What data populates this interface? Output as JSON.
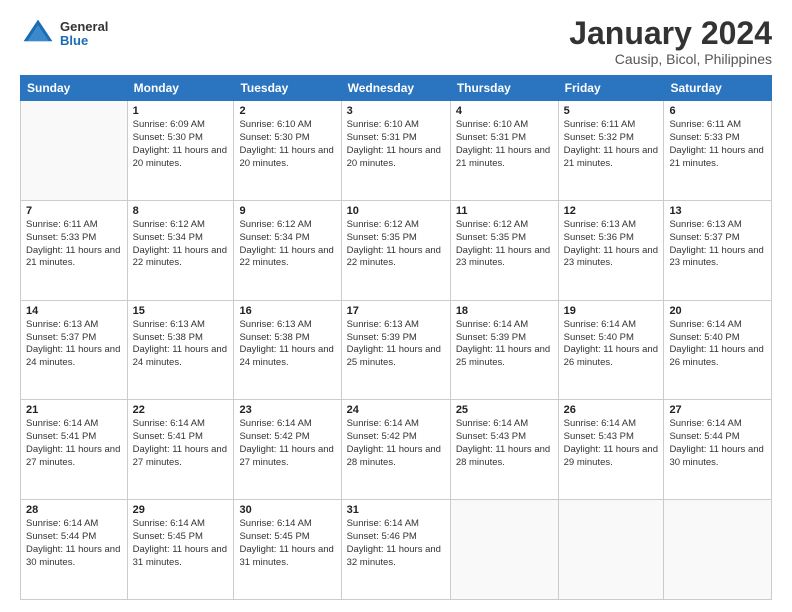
{
  "header": {
    "logo": {
      "general": "General",
      "blue": "Blue"
    },
    "title": "January 2024",
    "subtitle": "Causip, Bicol, Philippines"
  },
  "calendar": {
    "days_of_week": [
      "Sunday",
      "Monday",
      "Tuesday",
      "Wednesday",
      "Thursday",
      "Friday",
      "Saturday"
    ],
    "weeks": [
      [
        {
          "day": "",
          "info": ""
        },
        {
          "day": "1",
          "info": "Sunrise: 6:09 AM\nSunset: 5:30 PM\nDaylight: 11 hours\nand 20 minutes."
        },
        {
          "day": "2",
          "info": "Sunrise: 6:10 AM\nSunset: 5:30 PM\nDaylight: 11 hours\nand 20 minutes."
        },
        {
          "day": "3",
          "info": "Sunrise: 6:10 AM\nSunset: 5:31 PM\nDaylight: 11 hours\nand 20 minutes."
        },
        {
          "day": "4",
          "info": "Sunrise: 6:10 AM\nSunset: 5:31 PM\nDaylight: 11 hours\nand 21 minutes."
        },
        {
          "day": "5",
          "info": "Sunrise: 6:11 AM\nSunset: 5:32 PM\nDaylight: 11 hours\nand 21 minutes."
        },
        {
          "day": "6",
          "info": "Sunrise: 6:11 AM\nSunset: 5:33 PM\nDaylight: 11 hours\nand 21 minutes."
        }
      ],
      [
        {
          "day": "7",
          "info": "Sunrise: 6:11 AM\nSunset: 5:33 PM\nDaylight: 11 hours\nand 21 minutes."
        },
        {
          "day": "8",
          "info": "Sunrise: 6:12 AM\nSunset: 5:34 PM\nDaylight: 11 hours\nand 22 minutes."
        },
        {
          "day": "9",
          "info": "Sunrise: 6:12 AM\nSunset: 5:34 PM\nDaylight: 11 hours\nand 22 minutes."
        },
        {
          "day": "10",
          "info": "Sunrise: 6:12 AM\nSunset: 5:35 PM\nDaylight: 11 hours\nand 22 minutes."
        },
        {
          "day": "11",
          "info": "Sunrise: 6:12 AM\nSunset: 5:35 PM\nDaylight: 11 hours\nand 23 minutes."
        },
        {
          "day": "12",
          "info": "Sunrise: 6:13 AM\nSunset: 5:36 PM\nDaylight: 11 hours\nand 23 minutes."
        },
        {
          "day": "13",
          "info": "Sunrise: 6:13 AM\nSunset: 5:37 PM\nDaylight: 11 hours\nand 23 minutes."
        }
      ],
      [
        {
          "day": "14",
          "info": "Sunrise: 6:13 AM\nSunset: 5:37 PM\nDaylight: 11 hours\nand 24 minutes."
        },
        {
          "day": "15",
          "info": "Sunrise: 6:13 AM\nSunset: 5:38 PM\nDaylight: 11 hours\nand 24 minutes."
        },
        {
          "day": "16",
          "info": "Sunrise: 6:13 AM\nSunset: 5:38 PM\nDaylight: 11 hours\nand 24 minutes."
        },
        {
          "day": "17",
          "info": "Sunrise: 6:13 AM\nSunset: 5:39 PM\nDaylight: 11 hours\nand 25 minutes."
        },
        {
          "day": "18",
          "info": "Sunrise: 6:14 AM\nSunset: 5:39 PM\nDaylight: 11 hours\nand 25 minutes."
        },
        {
          "day": "19",
          "info": "Sunrise: 6:14 AM\nSunset: 5:40 PM\nDaylight: 11 hours\nand 26 minutes."
        },
        {
          "day": "20",
          "info": "Sunrise: 6:14 AM\nSunset: 5:40 PM\nDaylight: 11 hours\nand 26 minutes."
        }
      ],
      [
        {
          "day": "21",
          "info": "Sunrise: 6:14 AM\nSunset: 5:41 PM\nDaylight: 11 hours\nand 27 minutes."
        },
        {
          "day": "22",
          "info": "Sunrise: 6:14 AM\nSunset: 5:41 PM\nDaylight: 11 hours\nand 27 minutes."
        },
        {
          "day": "23",
          "info": "Sunrise: 6:14 AM\nSunset: 5:42 PM\nDaylight: 11 hours\nand 27 minutes."
        },
        {
          "day": "24",
          "info": "Sunrise: 6:14 AM\nSunset: 5:42 PM\nDaylight: 11 hours\nand 28 minutes."
        },
        {
          "day": "25",
          "info": "Sunrise: 6:14 AM\nSunset: 5:43 PM\nDaylight: 11 hours\nand 28 minutes."
        },
        {
          "day": "26",
          "info": "Sunrise: 6:14 AM\nSunset: 5:43 PM\nDaylight: 11 hours\nand 29 minutes."
        },
        {
          "day": "27",
          "info": "Sunrise: 6:14 AM\nSunset: 5:44 PM\nDaylight: 11 hours\nand 30 minutes."
        }
      ],
      [
        {
          "day": "28",
          "info": "Sunrise: 6:14 AM\nSunset: 5:44 PM\nDaylight: 11 hours\nand 30 minutes."
        },
        {
          "day": "29",
          "info": "Sunrise: 6:14 AM\nSunset: 5:45 PM\nDaylight: 11 hours\nand 31 minutes."
        },
        {
          "day": "30",
          "info": "Sunrise: 6:14 AM\nSunset: 5:45 PM\nDaylight: 11 hours\nand 31 minutes."
        },
        {
          "day": "31",
          "info": "Sunrise: 6:14 AM\nSunset: 5:46 PM\nDaylight: 11 hours\nand 32 minutes."
        },
        {
          "day": "",
          "info": ""
        },
        {
          "day": "",
          "info": ""
        },
        {
          "day": "",
          "info": ""
        }
      ]
    ]
  }
}
